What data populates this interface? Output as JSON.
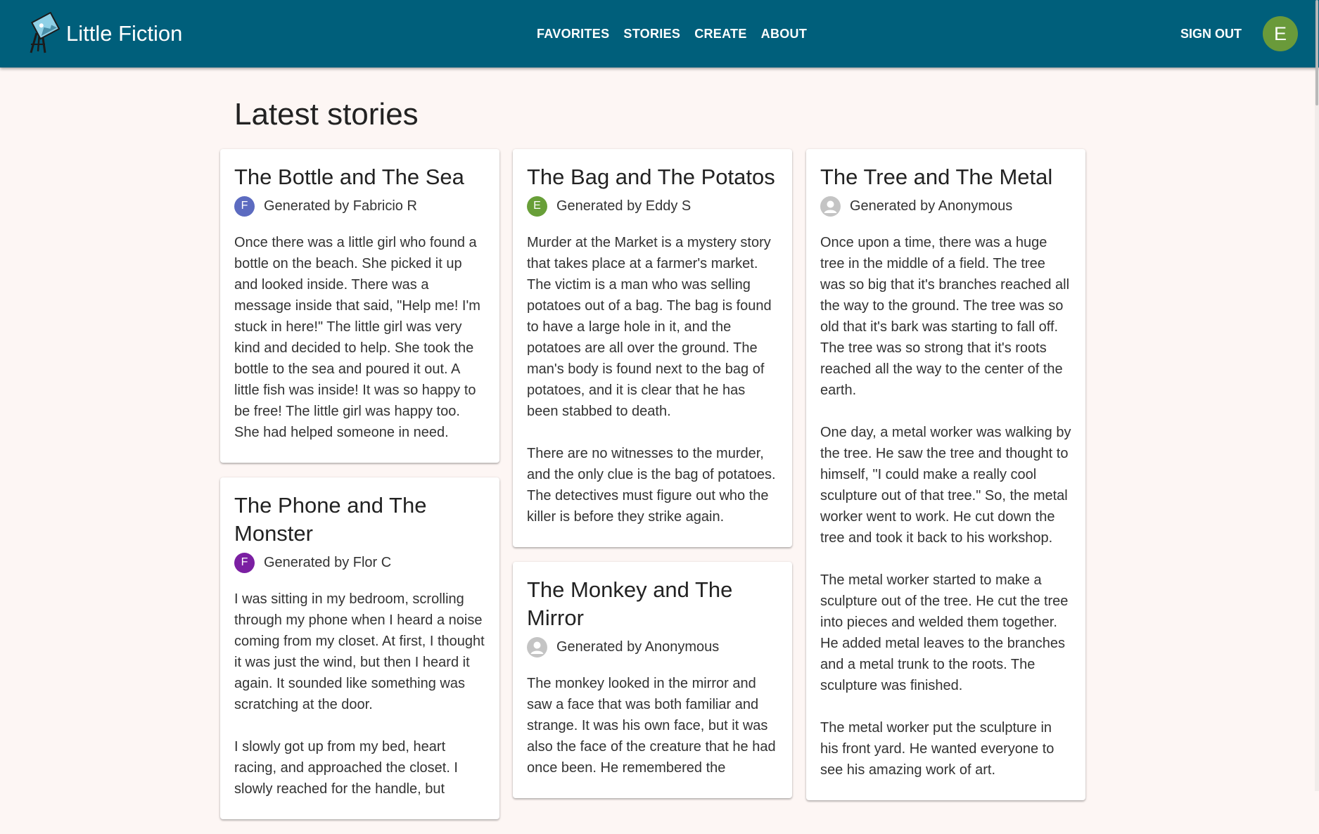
{
  "app": {
    "name": "Little Fiction",
    "logo_icon": "easel-icon"
  },
  "nav": {
    "items": [
      {
        "label": "FAVORITES"
      },
      {
        "label": "STORIES"
      },
      {
        "label": "CREATE"
      },
      {
        "label": "ABOUT"
      }
    ],
    "sign_out": "SIGN OUT",
    "user_initial": "E",
    "user_avatar_color": "#6a9a3a"
  },
  "page": {
    "title": "Latest stories"
  },
  "stories": [
    {
      "title": "The Bottle and The Sea",
      "byline": "Generated by Fabricio R",
      "avatar_initial": "F",
      "avatar_color": "#5c6bc0",
      "text": "Once there was a little girl who found a bottle on the beach. She picked it up and looked inside. There was a message inside that said, \"Help me! I'm stuck in here!\" The little girl was very kind and decided to help. She took the bottle to the sea and poured it out. A little fish was inside! It was so happy to be free! The little girl was happy too. She had helped someone in need."
    },
    {
      "title": "The Phone and The Monster",
      "byline": "Generated by Flor C",
      "avatar_initial": "F",
      "avatar_color": "#7b1fa2",
      "text": "I was sitting in my bedroom, scrolling through my phone when I heard a noise coming from my closet. At first, I thought it was just the wind, but then I heard it again. It sounded like something was scratching at the door.\n\nI slowly got up from my bed, heart racing, and approached the closet. I slowly reached for the handle, but"
    },
    {
      "title": "The Bag and The Potatos",
      "byline": "Generated by Eddy S",
      "avatar_initial": "E",
      "avatar_color": "#689f38",
      "text": "Murder at the Market is a mystery story that takes place at a farmer's market. The victim is a man who was selling potatoes out of a bag. The bag is found to have a large hole in it, and the potatoes are all over the ground. The man's body is found next to the bag of potatoes, and it is clear that he has been stabbed to death.\n\nThere are no witnesses to the murder, and the only clue is the bag of potatoes. The detectives must figure out who the killer is before they strike again."
    },
    {
      "title": "The Monkey and The Mirror",
      "byline": "Generated by Anonymous",
      "avatar_initial": "",
      "avatar_color": "#c4c4c4",
      "text": "The monkey looked in the mirror and saw a face that was both familiar and strange. It was his own face, but it was also the face of the creature that he had once been. He remembered the"
    },
    {
      "title": "The Tree and The Metal",
      "byline": "Generated by Anonymous",
      "avatar_initial": "",
      "avatar_color": "#c4c4c4",
      "text": "Once upon a time, there was a huge tree in the middle of a field. The tree was so big that it's branches reached all the way to the ground. The tree was so old that it's bark was starting to fall off. The tree was so strong that it's roots reached all the way to the center of the earth.\n\nOne day, a metal worker was walking by the tree. He saw the tree and thought to himself, \"I could make a really cool sculpture out of that tree.\" So, the metal worker went to work. He cut down the tree and took it back to his workshop.\n\nThe metal worker started to make a sculpture out of the tree. He cut the tree into pieces and welded them together. He added metal leaves to the branches and a metal trunk to the roots. The sculpture was finished.\n\nThe metal worker put the sculpture in his front yard. He wanted everyone to see his amazing work of art."
    }
  ]
}
